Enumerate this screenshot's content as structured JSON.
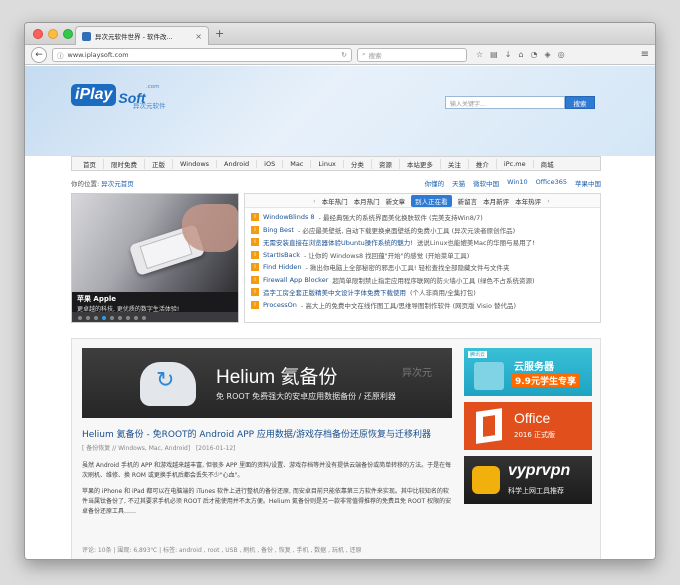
{
  "browser": {
    "tab_title": "异次元软件世界 - 软件改...",
    "url": "www.iplaysoft.com",
    "search_placeholder": "搜索"
  },
  "site": {
    "logo_main": "iPlay",
    "logo_soft": "Soft",
    "logo_com": ".com",
    "logo_sub": "异次元软件",
    "search_placeholder": "输入关键字...",
    "search_button": "搜索"
  },
  "nav": {
    "items": [
      "首页",
      "限时免费",
      "正版",
      "Windows",
      "Android",
      "iOS",
      "Mac",
      "Linux",
      "分类",
      "资源",
      "本站更多",
      "关注",
      "推介",
      "iPc.me",
      "商城"
    ]
  },
  "breadcrumb": {
    "label": "你的位置:",
    "link": "异次元首页"
  },
  "quicklinks": [
    "你懂的",
    "天猫",
    "微软中国",
    "Win10",
    "Office365",
    "苹果中国"
  ],
  "slider": {
    "caption_title": "苹果 Apple",
    "caption_desc": "更卓越的科技, 更优质的数字生活体验!",
    "dots": 9,
    "active_dot": 3
  },
  "news": {
    "tabs": [
      "本年热门",
      "本月热门",
      "新文章",
      "别人正在看",
      "新留言",
      "本月新评",
      "本年热评"
    ],
    "active_tab": "别人正在看",
    "items": [
      {
        "title": "WindowBlinds 8",
        "desc": " - 最经典强大的系统界面美化换肤软件 (完美支持Win8/7)"
      },
      {
        "title": "Bing Best",
        "desc": " - 必应最美壁纸, 自动下载更换桌面壁纸的免费小工具 (异次元读者原创作品)"
      },
      {
        "title": "无需安装直接在浏览器体验Ubuntu操作系统的魅力!",
        "desc": " 送说Linux也能媲美Mac的华丽与易用了!"
      },
      {
        "title": "StartIsBack",
        "desc": " - 让你的 Windows8 找回蕴\"开始\"的感觉 (开始菜单工具)"
      },
      {
        "title": "Find Hidden",
        "desc": " - 揪出你电脑上全部秘密的邪恶小工具! 轻松查找全部隐藏文件与文件夹"
      },
      {
        "title": "Firewall App Blocker",
        "desc": " 超简单限制禁止指定应用程序联网的防火墙小工具 (绿色不占系统资源)"
      },
      {
        "title": "造字工房全套正版精美中文设计字体免费下载使用",
        "desc": " (个人非商用/全集打包)"
      },
      {
        "title": "ProcessOn",
        "desc": " - 高大上的免费中文在线作图工具/思维导图制作软件 (网页版 Visio 替代品)"
      }
    ]
  },
  "article": {
    "banner_title": "Helium 氦备份",
    "banner_sub": "免 ROOT 免费强大的安卓应用数据备份 / 还原利器",
    "banner_watermark": "异次元",
    "title": "Helium 氦备份 - 免ROOT的 Android APP 应用数据/游戏存档备份还原恢复与迁移利器",
    "meta_category": "[ 备份恢复 // Windows, Mac, Android]",
    "meta_date": "[2016-01-12]",
    "para1": "虽然 Android 手机的 APP 和游戏越来越丰富, 但很多 APP 里面的资料/设置、游戏存档等并没有提供云端备份或简单转移的方法。于是在每次刷机、维修、换 ROM 或更换手机后都会丢失不少\"心血\"。",
    "para2": "苹果的 iPhone 和 iPad 都可以在电脑端的 iTunes 软件上进行整机的备份还原, 而安卓目前只能依靠第三方软件来实现。其中比较知名的软件当属钛备份了, 不过其要求手机必须 ROOT 后才能使用并不太方便。Helium 氦备份则是另一款非常值得推荐的免费且免 ROOT 权限的安卓备份还原工具……",
    "footer": "评论: 10条 | 围观: 6,893℃ | 标签: android , root , USB , 刷机 , 备份 , 恢复 , 手机 , 数据 , 玩机 , 还原"
  },
  "ads": {
    "cloud_badge": "腾讯云",
    "cloud_main": "云服务器",
    "cloud_offer": "9.9元学生专享",
    "office_main": "Office",
    "office_sub": "2016 正式版",
    "vypr_main": "vyprvpn",
    "vypr_sub": "科学上网工具推荐"
  }
}
